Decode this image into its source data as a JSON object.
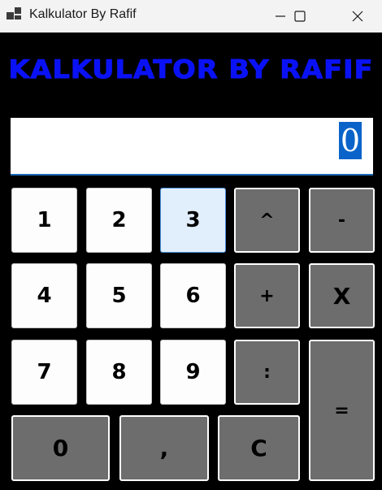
{
  "window": {
    "title": "Kalkulator By Rafif",
    "controls": {
      "minimize_icon": "minimize-icon",
      "maximize_icon": "maximize-icon",
      "close_icon": "close-icon"
    }
  },
  "app": {
    "heading": "KALKULATOR BY RAFIF",
    "heading_color": "#0a12f5",
    "display_value": "0"
  },
  "keypad": {
    "k1": "1",
    "k2": "2",
    "k3": "3",
    "pow": "^",
    "minus": "-",
    "k4": "4",
    "k5": "5",
    "k6": "6",
    "plus": "+",
    "times": "X",
    "k7": "7",
    "k8": "8",
    "k9": "9",
    "divide": ":",
    "equals": "=",
    "k0": "0",
    "comma": ",",
    "clear": "C"
  }
}
